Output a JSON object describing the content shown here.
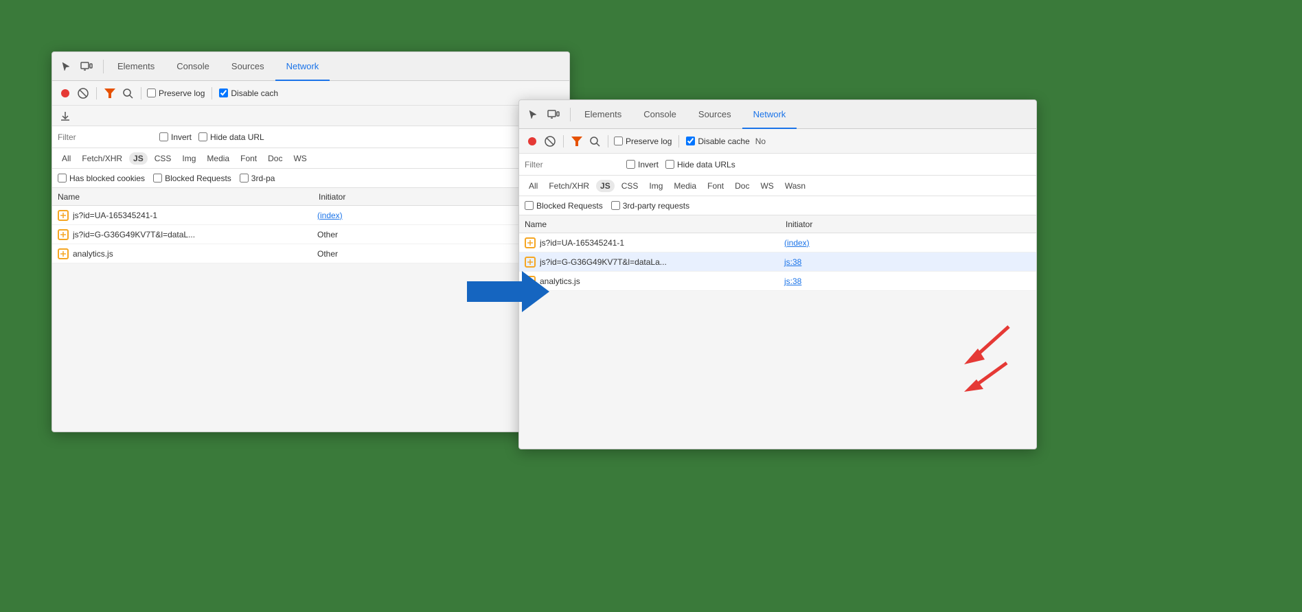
{
  "window1": {
    "tabs": [
      {
        "label": "Elements",
        "active": false
      },
      {
        "label": "Console",
        "active": false
      },
      {
        "label": "Sources",
        "active": false
      },
      {
        "label": "Network",
        "active": true
      }
    ],
    "toolbar": {
      "preserveLog": "Preserve log",
      "disableCache": "Disable cach",
      "filterPlaceholder": "Filter",
      "invert": "Invert",
      "hideDataUrls": "Hide data URL"
    },
    "resourceTypes": [
      "All",
      "Fetch/XHR",
      "JS",
      "CSS",
      "Img",
      "Media",
      "Font",
      "Doc",
      "WS"
    ],
    "activeResource": "JS",
    "checkboxes": [
      "Has blocked cookies",
      "Blocked Requests",
      "3rd-pa"
    ],
    "columns": [
      "Name",
      "Initiator"
    ],
    "rows": [
      {
        "name": "js?id=UA-165345241-1",
        "initiator": "(index)"
      },
      {
        "name": "js?id=G-G36G49KV7T&l=dataL...",
        "initiator": "Other"
      },
      {
        "name": "analytics.js",
        "initiator": "Other"
      }
    ]
  },
  "window2": {
    "tabs": [
      {
        "label": "Elements",
        "active": false
      },
      {
        "label": "Console",
        "active": false
      },
      {
        "label": "Sources",
        "active": false
      },
      {
        "label": "Network",
        "active": true
      }
    ],
    "toolbar": {
      "preserveLog": "Preserve log",
      "disableCache": "Disable cache",
      "extra": "No"
    },
    "filterPlaceholder": "Filter",
    "resourceTypes": [
      "All",
      "Fetch/XHR",
      "JS",
      "CSS",
      "Img",
      "Media",
      "Font",
      "Doc",
      "WS",
      "Wasn"
    ],
    "activeResource": "JS",
    "checkboxes": [
      "Blocked Requests",
      "3rd-party requests"
    ],
    "columns": [
      "Name",
      "Initiator"
    ],
    "rows": [
      {
        "name": "js?id=UA-165345241-1",
        "initiator": "(index)",
        "initiatorLink": false,
        "highlighted": false
      },
      {
        "name": "js?id=G-G36G49KV7T&l=dataLa...",
        "initiator": "js:38",
        "initiatorLink": true,
        "highlighted": true
      },
      {
        "name": "analytics.js",
        "initiator": "js:38",
        "initiatorLink": true,
        "highlighted": false
      }
    ]
  },
  "icons": {
    "record": "⏺",
    "clear": "🚫",
    "filter": "▼",
    "search": "🔍",
    "download": "⬇",
    "cursor": "↖",
    "device": "▭",
    "rowIcon": "⊕"
  }
}
